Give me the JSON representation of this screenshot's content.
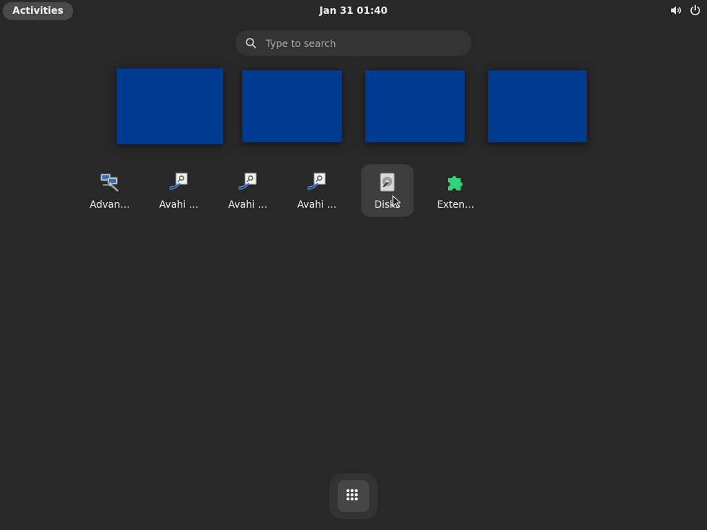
{
  "topbar": {
    "activities_label": "Activities",
    "clock": "Jan 31  01:40",
    "tray": [
      {
        "icon": "volume-icon"
      },
      {
        "icon": "power-icon"
      }
    ]
  },
  "search": {
    "placeholder": "Type to search",
    "value": ""
  },
  "workspaces": [
    {
      "color": "#003b92"
    },
    {
      "color": "#003b92"
    },
    {
      "color": "#003b92"
    },
    {
      "color": "#003b92"
    }
  ],
  "apps": [
    {
      "label": "Advan…",
      "icon": "network-connections-icon"
    },
    {
      "label": "Avahi …",
      "icon": "avahi-icon"
    },
    {
      "label": "Avahi …",
      "icon": "avahi-icon"
    },
    {
      "label": "Avahi …",
      "icon": "avahi-icon"
    },
    {
      "label": "Disks",
      "icon": "disks-icon"
    },
    {
      "label": "Exten…",
      "icon": "extensions-icon"
    }
  ],
  "dock": {
    "show_apps_icon": "app-grid-icon"
  }
}
